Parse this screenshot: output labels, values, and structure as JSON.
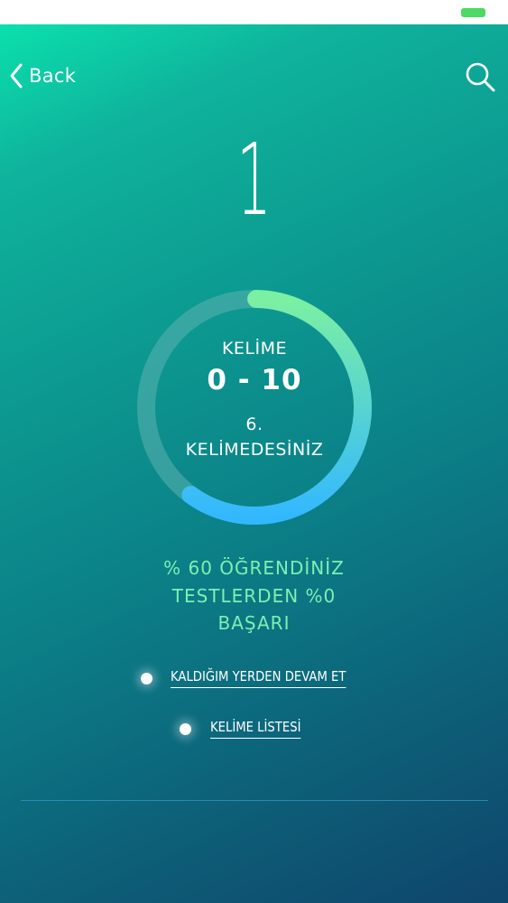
{
  "nav": {
    "back_label": "Back",
    "back_icon": "chevron-left-icon",
    "search_icon": "search-icon"
  },
  "set_number": "1",
  "progress": {
    "title": "KELİME",
    "range": "0 - 10",
    "position_line1": "6.",
    "position_line2": "KELİMEDESİNİZ",
    "percent": 60,
    "ring_color_start": "#7cf0a2",
    "ring_color_end": "#33b8ff",
    "track_color": "#5cb2b0"
  },
  "stats": {
    "learned": "% 60 ÖĞRENDİNİZ",
    "tests_line1": "TESTLERDEN %0",
    "tests_line2": "BAŞARI",
    "color": "#7ef0b0"
  },
  "options": {
    "continue_label": "KALDIĞIM YERDEN DEVAM ET",
    "word_list_label": "KELİME LİSTESİ"
  },
  "colors": {
    "battery": "#4cd964",
    "gradient_top": "#0be0ad",
    "gradient_bottom": "#0f456b"
  }
}
